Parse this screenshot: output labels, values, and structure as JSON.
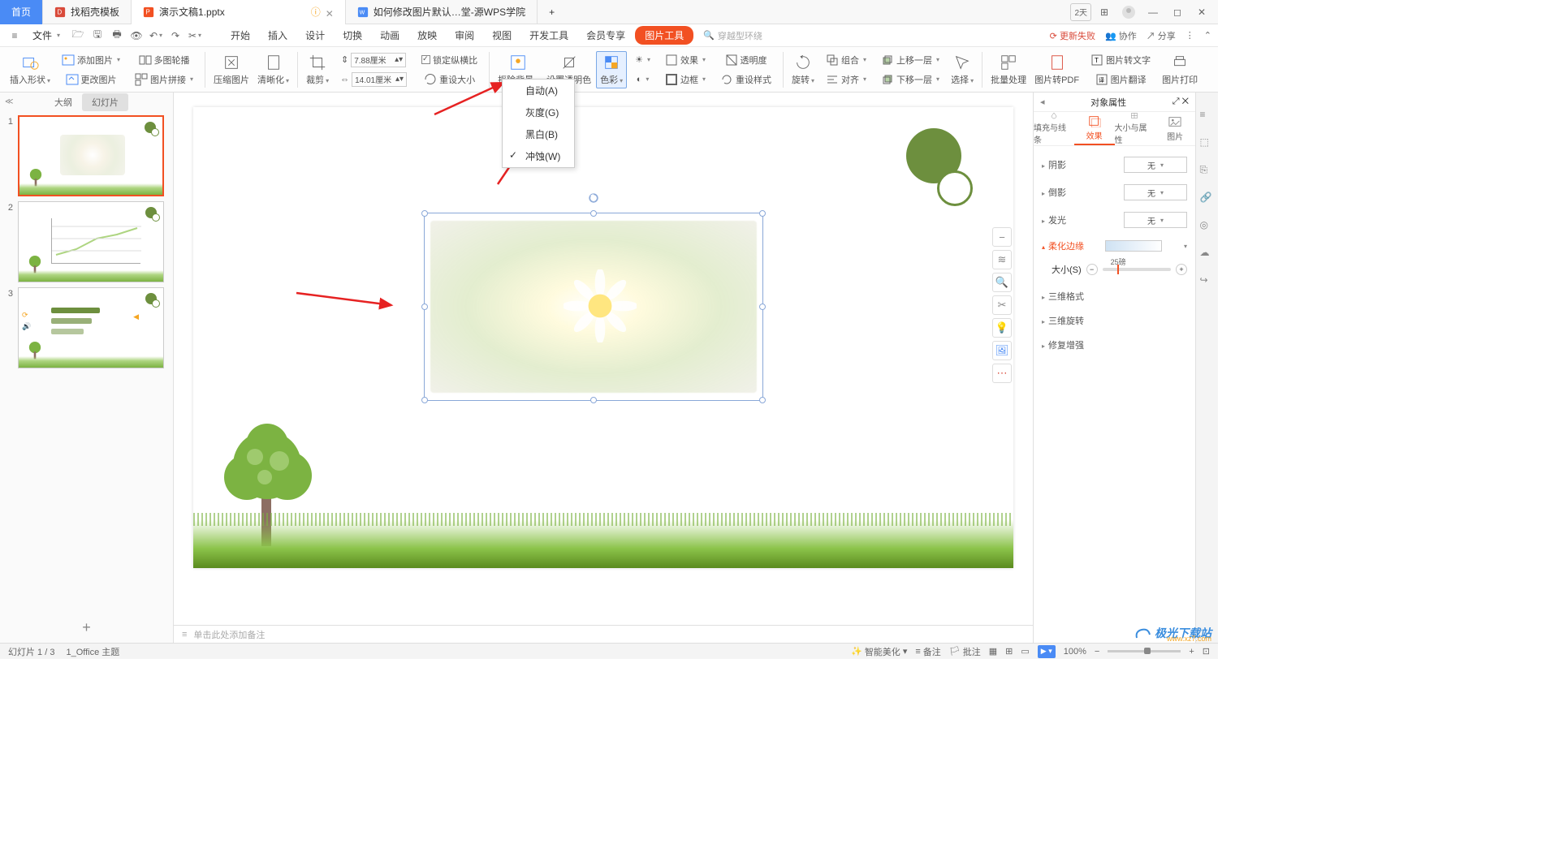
{
  "titlebar": {
    "home": "首页",
    "tabs": [
      {
        "name": "找稻壳模板",
        "icon_color": "#d94a3a"
      },
      {
        "name": "演示文稿1.pptx",
        "icon_color": "#f25022",
        "active": true,
        "warn": true
      },
      {
        "name": "如何修改图片默认…堂-源WPS学院",
        "icon_color": "#4a8bf5"
      }
    ],
    "trial_badge": "2天"
  },
  "menubar": {
    "file": "文件",
    "tabs": [
      "开始",
      "插入",
      "设计",
      "切换",
      "动画",
      "放映",
      "审阅",
      "视图",
      "开发工具",
      "会员专享"
    ],
    "image_tools": "图片工具",
    "search_placeholder": "穿越型环绕",
    "update_fail": "更新失败",
    "coop": "协作",
    "share": "分享"
  },
  "ribbon": {
    "insert_shape": "插入形状",
    "add_image": "添加图片",
    "change_image": "更改图片",
    "multi_outline": "多图轮播",
    "image_mosaic": "图片拼接",
    "compress": "压缩图片",
    "sharpen": "清晰化",
    "crop": "裁剪",
    "width": "7.88厘米",
    "height": "14.01厘米",
    "lock_ratio": "锁定纵横比",
    "reset_size": "重设大小",
    "remove_bg": "抠除背景",
    "set_transparent": "设置透明色",
    "color": "色彩",
    "effects": "效果",
    "border": "边框",
    "transparency": "透明度",
    "reset_style": "重设样式",
    "rotate": "旋转",
    "combine": "组合",
    "align": "对齐",
    "move_up": "上移一层",
    "move_down": "下移一层",
    "select": "选择",
    "batch": "批量处理",
    "to_pdf": "图片转PDF",
    "to_text": "图片转文字",
    "translate": "图片翻译",
    "print_img": "图片打印"
  },
  "dropdown": {
    "items": [
      "自动(A)",
      "灰度(G)",
      "黑白(B)",
      "冲蚀(W)"
    ],
    "checked": 3
  },
  "side_panel": {
    "outline": "大纲",
    "slides": "幻灯片"
  },
  "props": {
    "title": "对象属性",
    "tabs": [
      "填充与线条",
      "效果",
      "大小与属性",
      "图片"
    ],
    "shadow": "阴影",
    "reflection": "倒影",
    "glow": "发光",
    "none": "无",
    "soft_edge": "柔化边缘",
    "size": "大小(S)",
    "size_val": "25磅",
    "threed_fmt": "三维格式",
    "threed_rot": "三维旋转",
    "repair": "修复增强"
  },
  "notes_placeholder": "单击此处添加备注",
  "status": {
    "slide_pos": "幻灯片 1 / 3",
    "theme": "1_Office 主题",
    "beautify": "智能美化",
    "notes": "备注",
    "comments": "批注",
    "zoom": "100%"
  },
  "watermark": {
    "brand": "极光下载站",
    "url": "www.xz7.com"
  }
}
